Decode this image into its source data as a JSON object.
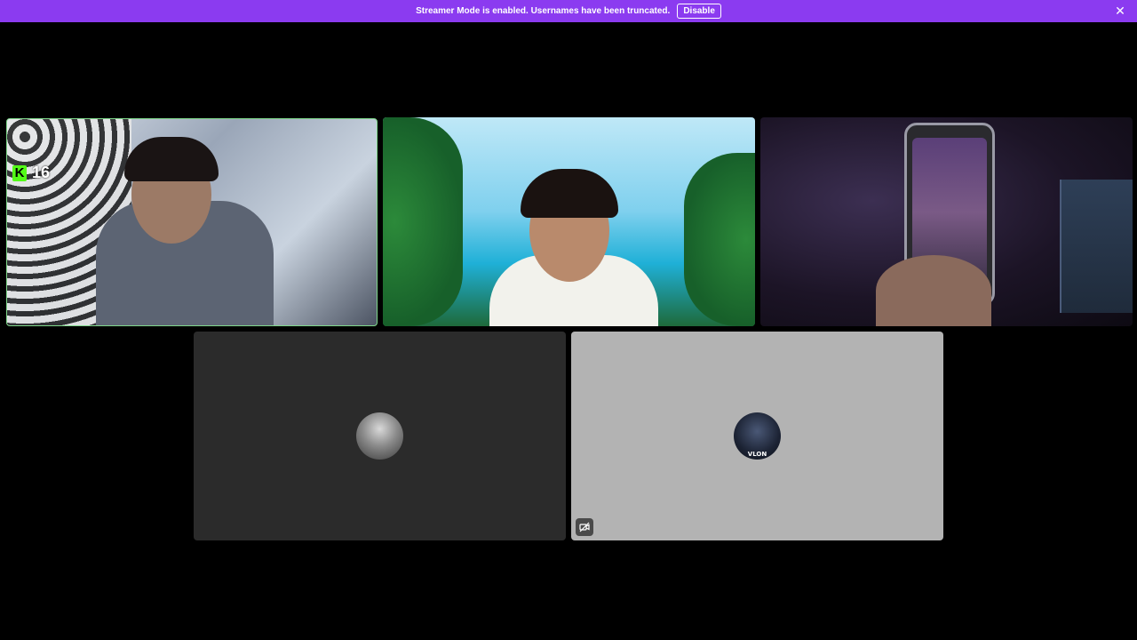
{
  "banner": {
    "message": "Streamer Mode is enabled. Usernames have been truncated.",
    "disable_label": "Disable",
    "close_icon": "close-icon",
    "color": "#8b3bf0"
  },
  "participants": {
    "video_1": {
      "badge_icon": "kick-logo",
      "badge_letter": "K",
      "badge_count": "16",
      "speaking_ring_color": "#7fd88b"
    },
    "audio_2": {
      "avatar_text": "VLON",
      "camera_off_icon": "camera-off-icon"
    }
  }
}
